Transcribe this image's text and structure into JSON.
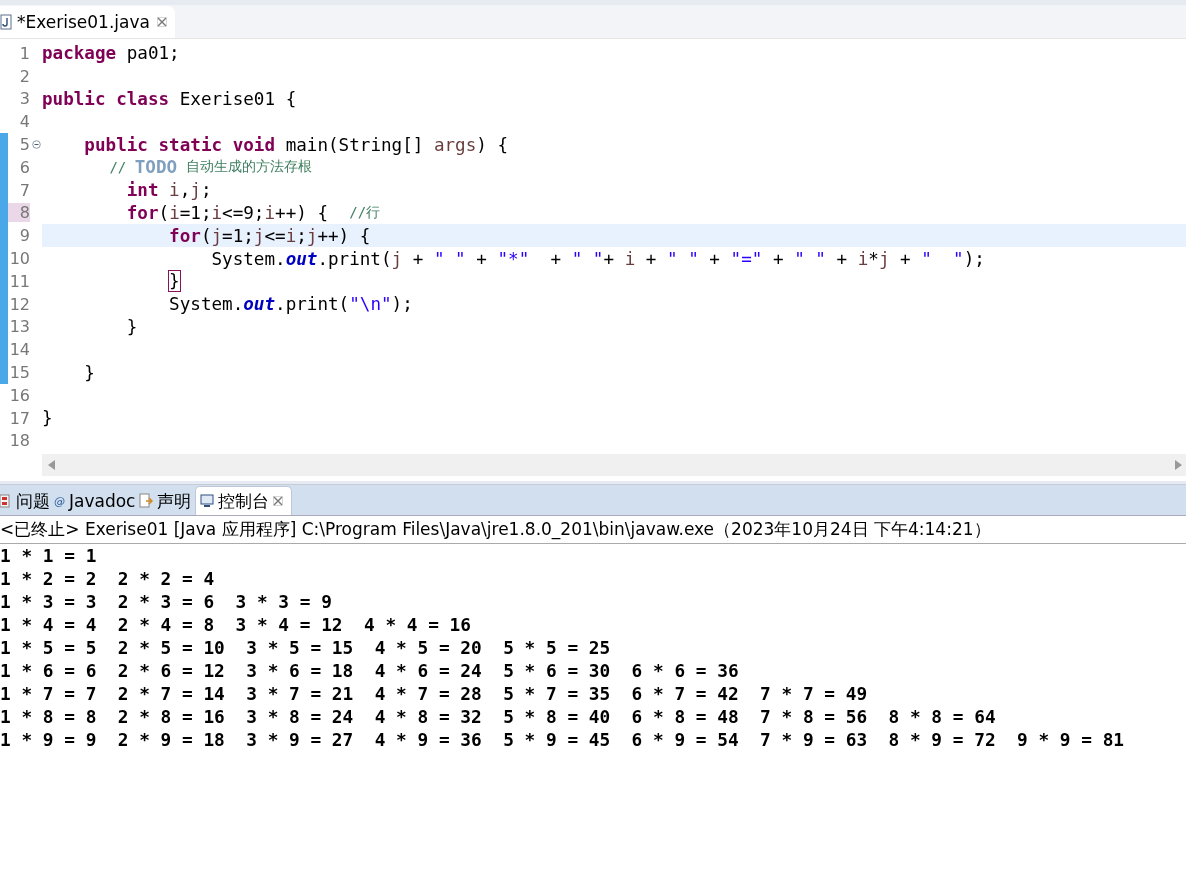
{
  "editor_tab": {
    "title": "*Exerise01.java",
    "selected": true
  },
  "code_lines": [
    {
      "number": "1",
      "current": false,
      "changed": false,
      "collapsible": false,
      "number_marked": false,
      "tokens": [
        {
          "kind": "keyword",
          "text": "package"
        },
        {
          "kind": "plain",
          "text": " pa01;"
        }
      ]
    },
    {
      "number": "2",
      "current": false,
      "changed": false,
      "collapsible": false,
      "number_marked": false
    },
    {
      "number": "3",
      "current": false,
      "changed": false,
      "collapsible": false,
      "number_marked": false,
      "tokens": [
        {
          "kind": "keyword",
          "text": "public class"
        },
        {
          "kind": "plain",
          "text": " Exerise01 {"
        }
      ]
    },
    {
      "number": "4",
      "current": false,
      "changed": false,
      "collapsible": false,
      "number_marked": false
    },
    {
      "number": "5",
      "current": false,
      "changed": true,
      "collapsible": true,
      "number_marked": false,
      "tokens": [
        {
          "kind": "keyword",
          "text": "    public static void"
        },
        {
          "kind": "plain",
          "text": " main(String[] "
        },
        {
          "kind": "variable",
          "text": "args"
        },
        {
          "kind": "plain",
          "text": ") {"
        }
      ]
    },
    {
      "number": "6",
      "current": false,
      "changed": true,
      "collapsible": false,
      "number_marked": false,
      "tokens": [
        {
          "kind": "comment",
          "text": "        // "
        },
        {
          "kind": "todo",
          "text": "TODO"
        },
        {
          "kind": "comment",
          "text": " 自动生成的方法存根"
        }
      ]
    },
    {
      "number": "7",
      "current": false,
      "changed": true,
      "collapsible": false,
      "number_marked": false,
      "tokens": [
        {
          "kind": "keyword",
          "text": "        int"
        },
        {
          "kind": "variable",
          "text": " i"
        },
        {
          "kind": "plain",
          "text": ","
        },
        {
          "kind": "variable",
          "text": "j"
        },
        {
          "kind": "plain",
          "text": ";"
        }
      ]
    },
    {
      "number": "8",
      "current": false,
      "changed": true,
      "collapsible": false,
      "number_marked": true,
      "tokens": [
        {
          "kind": "keyword",
          "text": "        for"
        },
        {
          "kind": "plain",
          "text": "("
        },
        {
          "kind": "variable",
          "text": "i"
        },
        {
          "kind": "plain",
          "text": "=1;"
        },
        {
          "kind": "variable",
          "text": "i"
        },
        {
          "kind": "plain",
          "text": "<=9;"
        },
        {
          "kind": "variable",
          "text": "i"
        },
        {
          "kind": "plain",
          "text": "++) {  "
        },
        {
          "kind": "comment",
          "text": "//行"
        }
      ]
    },
    {
      "number": "9",
      "current": true,
      "changed": true,
      "collapsible": false,
      "number_marked": false,
      "tokens": [
        {
          "kind": "keyword",
          "text": "            for"
        },
        {
          "kind": "plain",
          "text": "("
        },
        {
          "kind": "variable",
          "text": "j"
        },
        {
          "kind": "plain",
          "text": "=1;"
        },
        {
          "kind": "variable",
          "text": "j"
        },
        {
          "kind": "plain",
          "text": "<="
        },
        {
          "kind": "variable",
          "text": "i"
        },
        {
          "kind": "plain",
          "text": ";"
        },
        {
          "kind": "variable",
          "text": "j"
        },
        {
          "kind": "plain",
          "text": "++) {"
        }
      ]
    },
    {
      "number": "10",
      "current": false,
      "changed": true,
      "collapsible": false,
      "number_marked": false,
      "tokens": [
        {
          "kind": "plain",
          "text": "                System."
        },
        {
          "kind": "field",
          "text": "out"
        },
        {
          "kind": "plain",
          "text": ".print("
        },
        {
          "kind": "variable",
          "text": "j"
        },
        {
          "kind": "plain",
          "text": " + "
        },
        {
          "kind": "string",
          "text": "\" \""
        },
        {
          "kind": "plain",
          "text": " + "
        },
        {
          "kind": "string",
          "text": "\"*\""
        },
        {
          "kind": "plain",
          "text": "  + "
        },
        {
          "kind": "string",
          "text": "\" \""
        },
        {
          "kind": "plain",
          "text": "+ "
        },
        {
          "kind": "variable",
          "text": "i"
        },
        {
          "kind": "plain",
          "text": " + "
        },
        {
          "kind": "string",
          "text": "\" \""
        },
        {
          "kind": "plain",
          "text": " + "
        },
        {
          "kind": "string",
          "text": "\"=\""
        },
        {
          "kind": "plain",
          "text": " + "
        },
        {
          "kind": "string",
          "text": "\" \""
        },
        {
          "kind": "plain",
          "text": " + "
        },
        {
          "kind": "variable",
          "text": "i"
        },
        {
          "kind": "plain",
          "text": "*"
        },
        {
          "kind": "variable",
          "text": "j"
        },
        {
          "kind": "plain",
          "text": " + "
        },
        {
          "kind": "string",
          "text": "\"  \""
        },
        {
          "kind": "plain",
          "text": ");"
        }
      ]
    },
    {
      "number": "11",
      "current": false,
      "changed": true,
      "collapsible": false,
      "number_marked": false,
      "tokens": [
        {
          "kind": "bracket_match",
          "text": "            }"
        }
      ]
    },
    {
      "number": "12",
      "current": false,
      "changed": true,
      "collapsible": false,
      "number_marked": false,
      "tokens": [
        {
          "kind": "plain",
          "text": "            System."
        },
        {
          "kind": "field",
          "text": "out"
        },
        {
          "kind": "plain",
          "text": ".print("
        },
        {
          "kind": "string",
          "text": "\"\\n\""
        },
        {
          "kind": "plain",
          "text": ");"
        }
      ]
    },
    {
      "number": "13",
      "current": false,
      "changed": true,
      "collapsible": false,
      "number_marked": false,
      "tokens": [
        {
          "kind": "plain",
          "text": "        }"
        }
      ]
    },
    {
      "number": "14",
      "current": false,
      "changed": true,
      "collapsible": false,
      "number_marked": false
    },
    {
      "number": "15",
      "current": false,
      "changed": true,
      "collapsible": false,
      "number_marked": false,
      "tokens": [
        {
          "kind": "plain",
          "text": "    }"
        }
      ]
    },
    {
      "number": "16",
      "current": false,
      "changed": false,
      "collapsible": false,
      "number_marked": false
    },
    {
      "number": "17",
      "current": false,
      "changed": false,
      "collapsible": false,
      "number_marked": false,
      "tokens": [
        {
          "kind": "plain",
          "text": "}"
        }
      ]
    },
    {
      "number": "18",
      "current": false,
      "changed": false,
      "collapsible": false,
      "number_marked": false
    }
  ],
  "panel_tabs": [
    {
      "label": "问题",
      "kind": "problems",
      "selected": false
    },
    {
      "label": "Javadoc",
      "kind": "javadoc",
      "icon_text": "@",
      "selected": false
    },
    {
      "label": "声明",
      "kind": "declaration",
      "selected": false
    },
    {
      "label": "控制台",
      "kind": "console",
      "selected": true
    }
  ],
  "console": {
    "header": "<已终止> Exerise01 [Java 应用程序] C:\\Program Files\\Java\\jre1.8.0_201\\bin\\javaw.exe（2023年10月24日 下午4:14:21）",
    "output": [
      "1 * 1 = 1",
      "1 * 2 = 2  2 * 2 = 4",
      "1 * 3 = 3  2 * 3 = 6  3 * 3 = 9",
      "1 * 4 = 4  2 * 4 = 8  3 * 4 = 12  4 * 4 = 16",
      "1 * 5 = 5  2 * 5 = 10  3 * 5 = 15  4 * 5 = 20  5 * 5 = 25",
      "1 * 6 = 6  2 * 6 = 12  3 * 6 = 18  4 * 6 = 24  5 * 6 = 30  6 * 6 = 36",
      "1 * 7 = 7  2 * 7 = 14  3 * 7 = 21  4 * 7 = 28  5 * 7 = 35  6 * 7 = 42  7 * 7 = 49",
      "1 * 8 = 8  2 * 8 = 16  3 * 8 = 24  4 * 8 = 32  5 * 8 = 40  6 * 8 = 48  7 * 8 = 56  8 * 8 = 64",
      "1 * 9 = 9  2 * 9 = 18  3 * 9 = 27  4 * 9 = 36  5 * 9 = 45  6 * 9 = 54  7 * 9 = 63  8 * 9 = 72  9 * 9 = 81"
    ]
  }
}
